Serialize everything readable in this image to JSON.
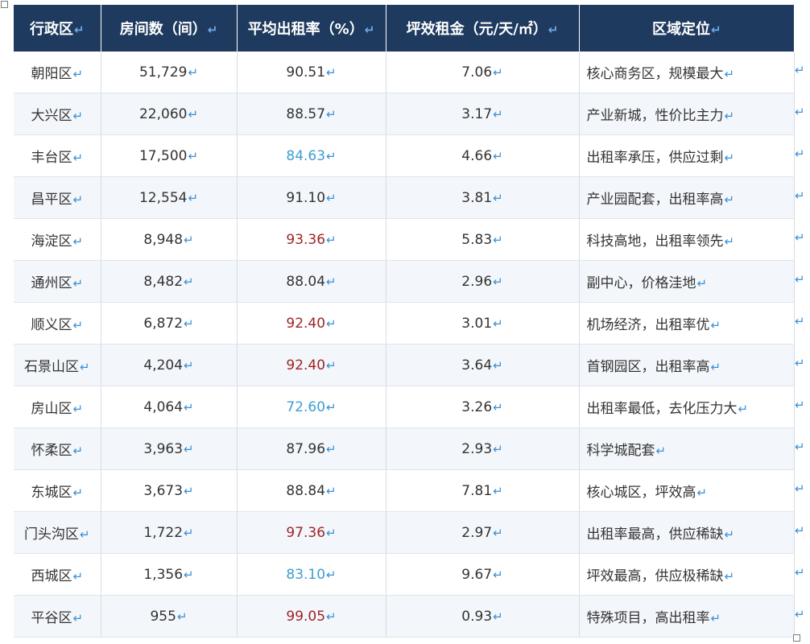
{
  "header": {
    "district": "行政区",
    "rooms": "房间数（间）",
    "occupancy": "平均出租率（%）",
    "rent": "坪效租金（元/天/㎡）",
    "positioning": "区域定位"
  },
  "paragraph_mark": "↵",
  "colors": {
    "header_bg": "#1f3a5f",
    "rate_high": "#a12424",
    "rate_low": "#3c9fd3",
    "paragraph_mark": "#3a8fd6"
  },
  "rows": [
    {
      "district": "朝阳区",
      "rooms": "51,729",
      "occupancy": "90.51",
      "rate_level": "normal",
      "rent": "7.06",
      "positioning": "核心商务区，规模最大"
    },
    {
      "district": "大兴区",
      "rooms": "22,060",
      "occupancy": "88.57",
      "rate_level": "normal",
      "rent": "3.17",
      "positioning": "产业新城，性价比主力"
    },
    {
      "district": "丰台区",
      "rooms": "17,500",
      "occupancy": "84.63",
      "rate_level": "low",
      "rent": "4.66",
      "positioning": "出租率承压，供应过剩"
    },
    {
      "district": "昌平区",
      "rooms": "12,554",
      "occupancy": "91.10",
      "rate_level": "normal",
      "rent": "3.81",
      "positioning": "产业园配套，出租率高"
    },
    {
      "district": "海淀区",
      "rooms": "8,948",
      "occupancy": "93.36",
      "rate_level": "high",
      "rent": "5.83",
      "positioning": "科技高地，出租率领先"
    },
    {
      "district": "通州区",
      "rooms": "8,482",
      "occupancy": "88.04",
      "rate_level": "normal",
      "rent": "2.96",
      "positioning": "副中心，价格洼地"
    },
    {
      "district": "顺义区",
      "rooms": "6,872",
      "occupancy": "92.40",
      "rate_level": "high",
      "rent": "3.01",
      "positioning": "机场经济，出租率优"
    },
    {
      "district": "石景山区",
      "rooms": "4,204",
      "occupancy": "92.40",
      "rate_level": "high",
      "rent": "3.64",
      "positioning": "首钢园区，出租率高"
    },
    {
      "district": "房山区",
      "rooms": "4,064",
      "occupancy": "72.60",
      "rate_level": "low",
      "rent": "3.26",
      "positioning": "出租率最低，去化压力大"
    },
    {
      "district": "怀柔区",
      "rooms": "3,963",
      "occupancy": "87.96",
      "rate_level": "normal",
      "rent": "2.93",
      "positioning": "科学城配套"
    },
    {
      "district": "东城区",
      "rooms": "3,673",
      "occupancy": "88.84",
      "rate_level": "normal",
      "rent": "7.81",
      "positioning": "核心城区，坪效高"
    },
    {
      "district": "门头沟区",
      "rooms": "1,722",
      "occupancy": "97.36",
      "rate_level": "high",
      "rent": "2.97",
      "positioning": "出租率最高，供应稀缺"
    },
    {
      "district": "西城区",
      "rooms": "1,356",
      "occupancy": "83.10",
      "rate_level": "low",
      "rent": "9.67",
      "positioning": "坪效最高，供应极稀缺"
    },
    {
      "district": "平谷区",
      "rooms": "955",
      "occupancy": "99.05",
      "rate_level": "high",
      "rent": "0.93",
      "positioning": "特殊项目，高出租率"
    }
  ]
}
